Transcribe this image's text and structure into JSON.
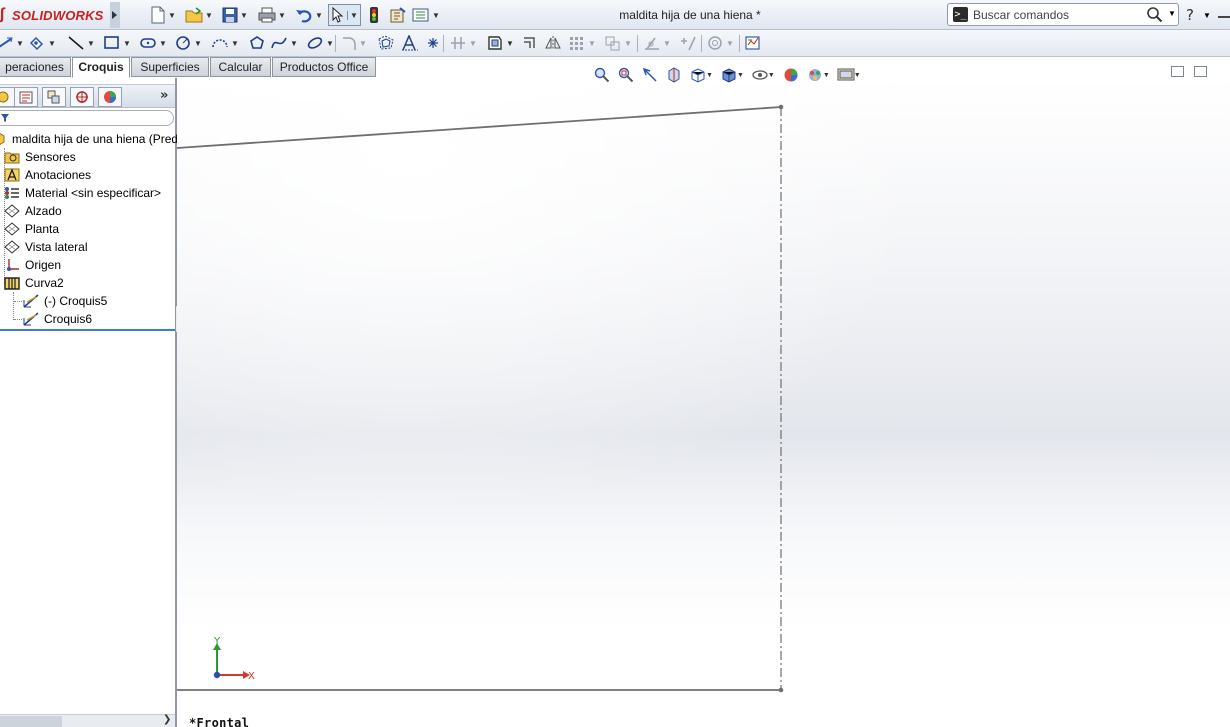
{
  "app": {
    "brand": "SOLIDWORKS"
  },
  "window": {
    "title": "maldita hija de una hiena *"
  },
  "search": {
    "placeholder": "Buscar comandos"
  },
  "help": {
    "label": "?"
  },
  "tabs": [
    {
      "label": "Operaciones",
      "visible_text": "peraciones",
      "active": false
    },
    {
      "label": "Croquis",
      "active": true
    },
    {
      "label": "Superficies",
      "active": false
    },
    {
      "label": "Calcular",
      "active": false
    },
    {
      "label": "Productos Office",
      "active": false
    }
  ],
  "feature_tree": {
    "root": "maldita hija de una hiena  (Pred",
    "items": [
      {
        "label": "Sensores",
        "icon": "sensor-folder-icon"
      },
      {
        "label": "Anotaciones",
        "icon": "annotations-icon"
      },
      {
        "label": "Material <sin especificar>",
        "icon": "material-icon"
      },
      {
        "label": "Alzado",
        "icon": "plane-icon"
      },
      {
        "label": "Planta",
        "icon": "plane-icon"
      },
      {
        "label": "Vista lateral",
        "icon": "plane-icon"
      },
      {
        "label": "Origen",
        "icon": "origin-icon"
      },
      {
        "label": "Curva2",
        "icon": "curve-feature-icon"
      }
    ],
    "children": [
      {
        "label": "(-) Croquis5",
        "icon": "sketch-icon"
      },
      {
        "label": "Croquis6",
        "icon": "sketch-icon"
      }
    ],
    "more": "»"
  },
  "graphics": {
    "view_label": "*Frontal",
    "triad": {
      "x_label": "X",
      "y_label": "Y"
    }
  },
  "colors": {
    "brand_red": "#cc1f1f",
    "selection_blue": "#3f7bd0",
    "sketch_line": "#6f6f6f"
  }
}
